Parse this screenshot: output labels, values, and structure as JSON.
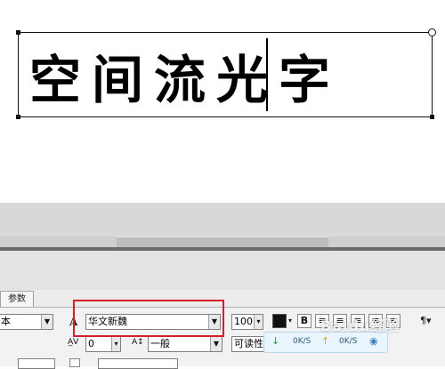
{
  "canvas": {
    "text": "空间流光字"
  },
  "panel": {
    "tab_label": "参数",
    "style_dropdown_value": "本",
    "font_dropdown_value": "华文新魏",
    "font_size_value": "100",
    "bold_label": "B",
    "spacing_value": "0",
    "baseline_value": "一般",
    "readability_value": "可读性"
  },
  "status": {
    "down_speed": "0K/S",
    "up_speed": "0K/S"
  },
  "watermark": "Baidu经验",
  "colors": {
    "highlight_box": "#d3202a",
    "status_bg": "#e9f6ff",
    "download_arrow": "#2aa02a",
    "upload_arrow": "#e6a800"
  }
}
